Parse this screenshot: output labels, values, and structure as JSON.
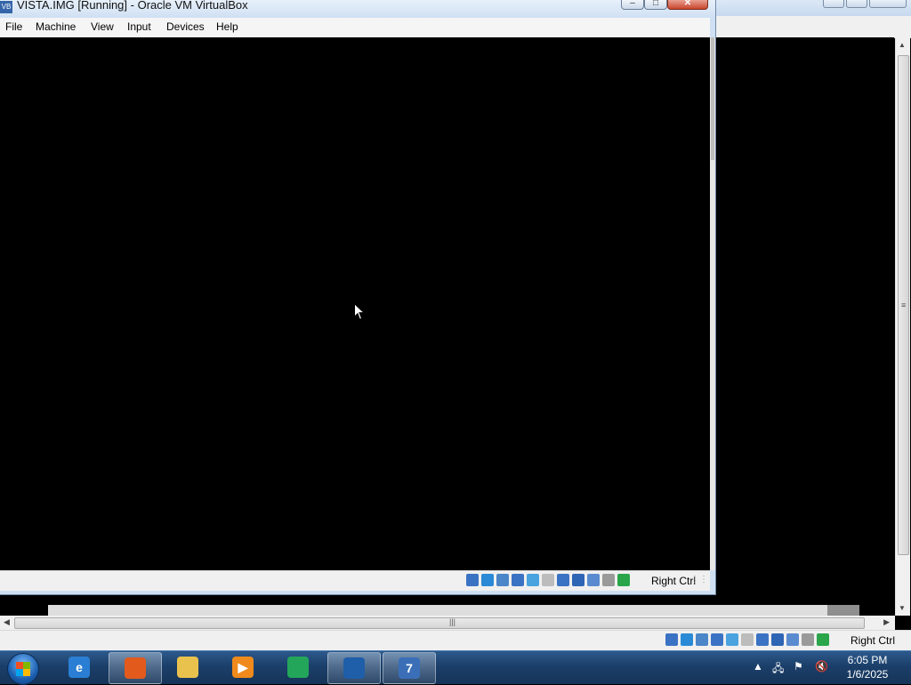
{
  "inner_window": {
    "title": "VISTA.IMG [Running] - Oracle VM VirtualBox",
    "menu": [
      "File",
      "Machine",
      "View",
      "Input",
      "Devices",
      "Help"
    ],
    "status_hostkey": "Right Ctrl",
    "status_icons": [
      "hard-disk-icon",
      "optical-drive-icon",
      "audio-icon",
      "network-icon",
      "usb-icon",
      "shared-folder-icon",
      "display-icon",
      "video-capture-icon",
      "virtualization-icon",
      "mouse-integration-icon",
      "host-key-arrow-icon"
    ]
  },
  "outer_window": {
    "status_hostkey": "Right Ctrl",
    "status_icons": [
      "hard-disk-icon",
      "optical-drive-icon",
      "audio-icon",
      "network-icon",
      "usb-icon",
      "shared-folder-icon",
      "display-icon",
      "video-capture-icon",
      "virtualization-icon",
      "mouse-integration-icon",
      "host-key-arrow-icon"
    ]
  },
  "taskbar": {
    "apps": [
      {
        "name": "internet-explorer",
        "glyph": "e",
        "color": "#2a7fd4",
        "active": false
      },
      {
        "name": "firefox",
        "glyph": "",
        "color": "#e25a1c",
        "active": true
      },
      {
        "name": "file-explorer",
        "glyph": "",
        "color": "#e9c24d",
        "active": false
      },
      {
        "name": "media-player",
        "glyph": "▶",
        "color": "#f08a1c",
        "active": false
      },
      {
        "name": "green-app",
        "glyph": "",
        "color": "#23a65a",
        "active": false
      },
      {
        "name": "virtualbox",
        "glyph": "",
        "color": "#1f5ea8",
        "active": true
      },
      {
        "name": "vm-window",
        "glyph": "7",
        "color": "#3a6fb8",
        "active": true
      }
    ],
    "clock": {
      "time": "6:05 PM",
      "date": "1/6/2025"
    }
  }
}
